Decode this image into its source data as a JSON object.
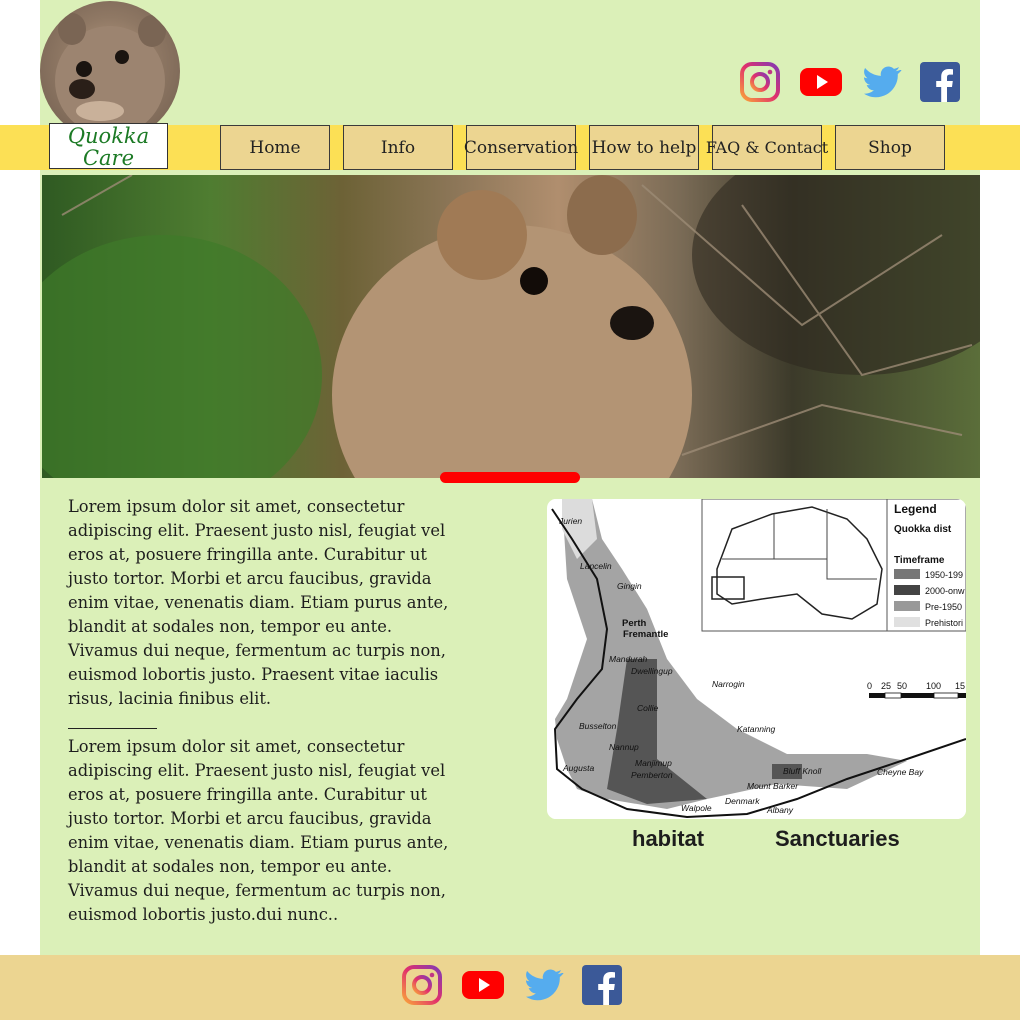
{
  "brand": {
    "logo_line1": "Quokka",
    "logo_line2": "Care"
  },
  "nav": {
    "items": [
      {
        "label": "Home"
      },
      {
        "label": "Info"
      },
      {
        "label": "Conservation"
      },
      {
        "label": "How to help"
      },
      {
        "label": "FAQ & Contact"
      },
      {
        "label": "Shop"
      }
    ]
  },
  "social": {
    "icons": [
      "instagram-icon",
      "youtube-icon",
      "twitter-icon",
      "facebook-icon"
    ]
  },
  "content": {
    "paragraph1": "Lorem ipsum dolor sit amet, consectetur adipiscing elit. Praesent justo nisl, feugiat vel eros at, posuere fringilla ante. Curabitur ut justo tortor. Morbi et arcu faucibus, gravida enim vitae, venenatis diam. Etiam purus ante, blandit at sodales non, tempor eu ante. Vivamus dui neque, fermentum ac turpis non, euismod lobortis justo. Praesent vitae iaculis risus, lacinia finibus elit.",
    "paragraph2": "Lorem ipsum dolor sit amet, consectetur adipiscing elit. Praesent justo nisl, feugiat vel eros at, posuere fringilla ante. Curabitur ut justo tortor. Morbi et arcu faucibus, gravida enim vitae, venenatis diam. Etiam purus ante, blandit at sodales non, tempor eu ante. Vivamus dui neque, fermentum ac turpis non, euismod lobortis justo.dui nunc.."
  },
  "map": {
    "legend_title": "Legend",
    "legend_subtitle": "Quokka dist",
    "timeframe_label": "Timeframe",
    "legend_items": [
      "1950-199",
      "2000-onw",
      "Pre-1950",
      "Prehistori"
    ],
    "scale_labels": [
      "0",
      "25",
      "50",
      "100",
      "15"
    ],
    "places": [
      "Jurien",
      "Lancelin",
      "Gingin",
      "Perth",
      "Fremantle",
      "Mandurah",
      "Dwellingup",
      "Narrogin",
      "Collie",
      "Katanning",
      "Busselton",
      "Nannup",
      "Manjimup",
      "Augusta",
      "Pemberton",
      "Bluff Knoll",
      "Mount Barker",
      "Denmark",
      "Walpole",
      "Albany",
      "Cheyne Bay"
    ]
  },
  "captions": {
    "habitat": "habitat",
    "sanctuaries": "Sanctuaries"
  },
  "colors": {
    "page_bg": "#dbf0b8",
    "nav_bar": "#fce055",
    "nav_button": "#ecd591",
    "footer": "#ecd591",
    "slider": "#ff0000"
  }
}
